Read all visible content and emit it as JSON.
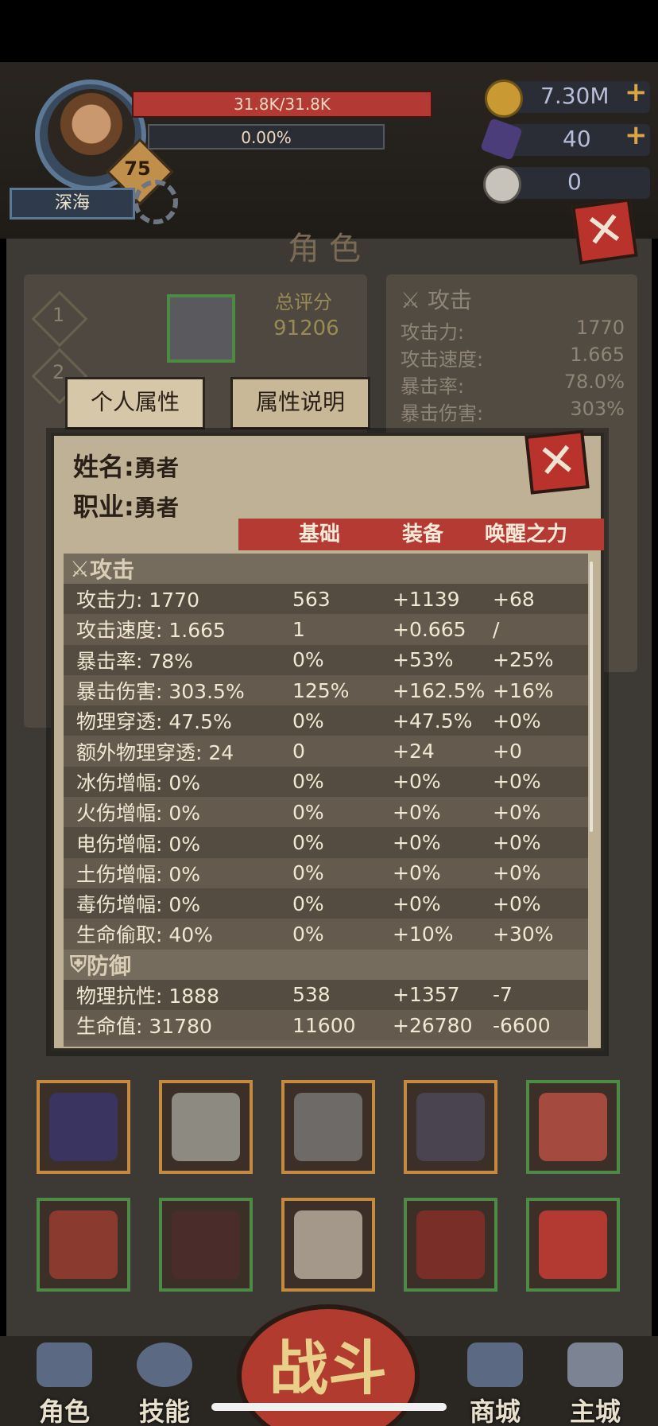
{
  "header": {
    "player_name": "深海",
    "level": "75",
    "hp_text": "31.8K/31.8K",
    "exp_text": "0.00%",
    "currencies": [
      {
        "icon": "gold-coin-icon",
        "value": "7.30M",
        "has_plus": true
      },
      {
        "icon": "purple-crystal-icon",
        "value": "40",
        "has_plus": true
      },
      {
        "icon": "ram-skull-icon",
        "value": "0",
        "has_plus": false
      }
    ]
  },
  "page": {
    "title": "角色",
    "stages": [
      "1",
      "2"
    ],
    "score_label": "总评分",
    "score_value": "91206",
    "tabs": [
      "个人属性",
      "属性说明"
    ],
    "right_panel": {
      "section": "攻击",
      "rows": [
        {
          "label": "攻击力:",
          "value": "1770"
        },
        {
          "label": "攻击速度:",
          "value": "1.665"
        },
        {
          "label": "暴击率:",
          "value": "78.0%"
        },
        {
          "label": "暴击伤害:",
          "value": "303%"
        }
      ]
    }
  },
  "modal": {
    "name_label": "姓名:",
    "name_value": "勇者",
    "class_label": "职业:",
    "class_value": "勇者",
    "columns": [
      "基础",
      "装备",
      "唤醒之力"
    ],
    "sections": [
      {
        "title": "攻击",
        "icon": "crossed-swords-icon",
        "rows": [
          [
            "攻击力: 1770",
            "563",
            "+1139",
            "+68"
          ],
          [
            "攻击速度: 1.665",
            "1",
            "+0.665",
            "/"
          ],
          [
            "暴击率: 78%",
            "0%",
            "+53%",
            "+25%"
          ],
          [
            "暴击伤害: 303.5%",
            "125%",
            "+162.5%",
            "+16%"
          ],
          [
            "物理穿透: 47.5%",
            "0%",
            "+47.5%",
            "+0%"
          ],
          [
            "额外物理穿透: 24",
            "0",
            "+24",
            "+0"
          ],
          [
            "冰伤增幅: 0%",
            "0%",
            "+0%",
            "+0%"
          ],
          [
            "火伤增幅: 0%",
            "0%",
            "+0%",
            "+0%"
          ],
          [
            "电伤增幅: 0%",
            "0%",
            "+0%",
            "+0%"
          ],
          [
            "土伤增幅: 0%",
            "0%",
            "+0%",
            "+0%"
          ],
          [
            "毒伤增幅: 0%",
            "0%",
            "+0%",
            "+0%"
          ],
          [
            "生命偷取: 40%",
            "0%",
            "+10%",
            "+30%"
          ]
        ]
      },
      {
        "title": "防御",
        "icon": "shield-icon",
        "rows": [
          [
            "物理抗性: 1888",
            "538",
            "+1357",
            "-7"
          ],
          [
            "生命值: 31780",
            "11600",
            "+26780",
            "-6600"
          ]
        ]
      }
    ]
  },
  "nav": {
    "items": [
      "角色",
      "技能",
      "战斗",
      "商城",
      "主城"
    ]
  },
  "colors": {
    "accent_red": "#b53a33",
    "gold": "#d9a547",
    "panel": "#bfb196"
  }
}
